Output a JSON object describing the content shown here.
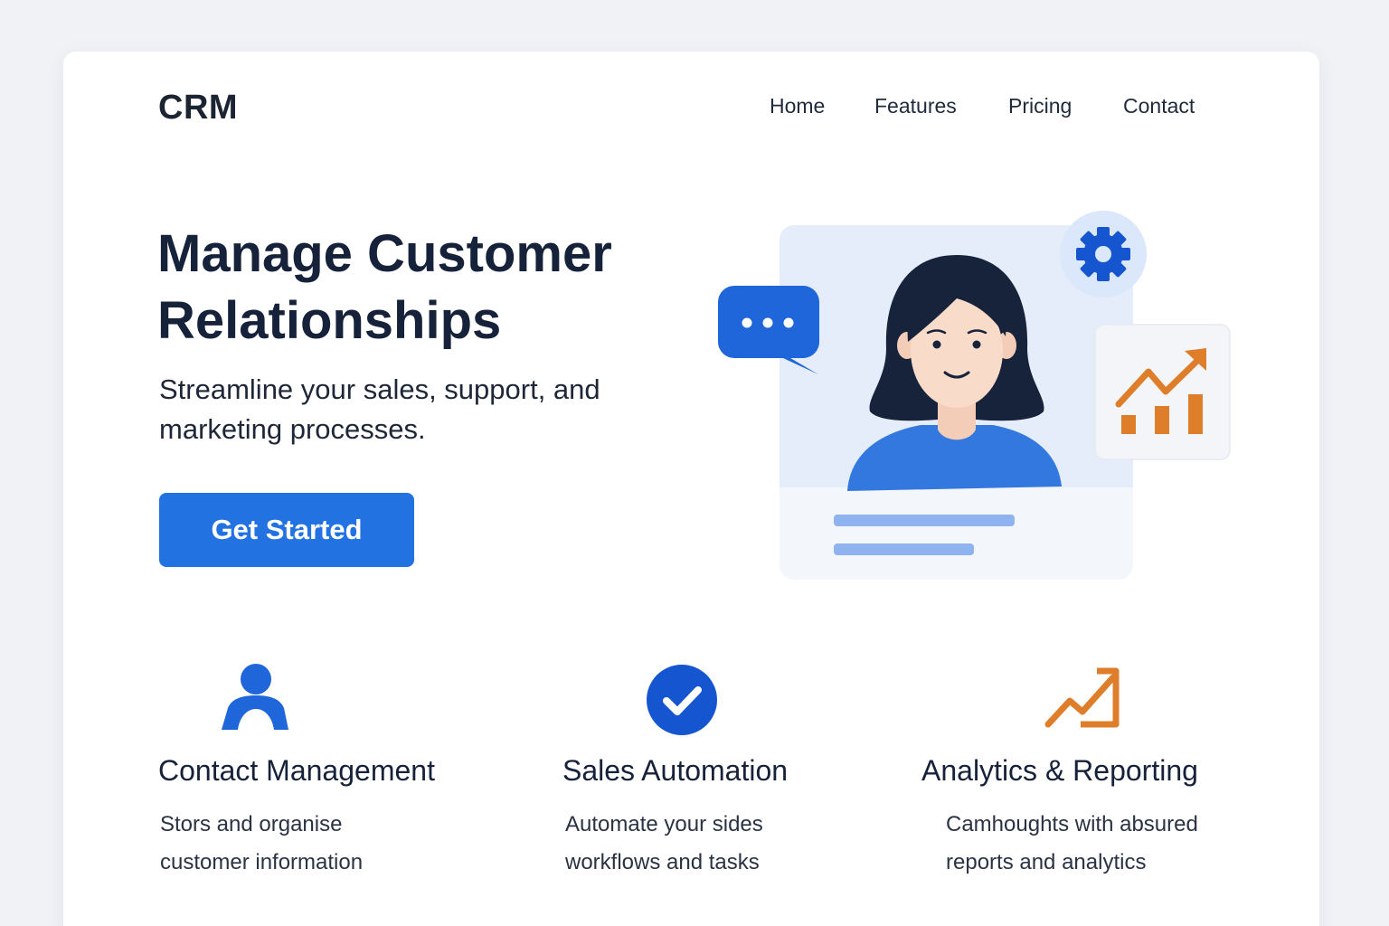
{
  "brand": {
    "logo": "CRM"
  },
  "nav": {
    "items": [
      {
        "label": "Home"
      },
      {
        "label": "Features"
      },
      {
        "label": "Pricing"
      },
      {
        "label": "Contact"
      }
    ]
  },
  "hero": {
    "title_line1": "Manage Customer",
    "title_line2": "Relationships",
    "subtitle_line1": "Streamline your sales, support, and",
    "subtitle_line2": "marketing processes.",
    "cta_label": "Get Started"
  },
  "features": [
    {
      "icon": "user-icon",
      "title": "Contact Management",
      "desc_line1": "Stors and organise",
      "desc_line2": "customer information"
    },
    {
      "icon": "checkmark-circle-icon",
      "title": "Sales Automation",
      "desc_line1": "Automate your sides",
      "desc_line2": "workflows and tasks"
    },
    {
      "icon": "trend-up-icon",
      "title": "Analytics & Reporting",
      "desc_line1": "Camhoughts with absured",
      "desc_line2": "reports and analytics"
    }
  ],
  "colors": {
    "primary": "#2272e2",
    "accent_orange": "#de7d2a",
    "text_dark": "#16213a",
    "background": "#f0f2f6",
    "card": "#ffffff"
  }
}
